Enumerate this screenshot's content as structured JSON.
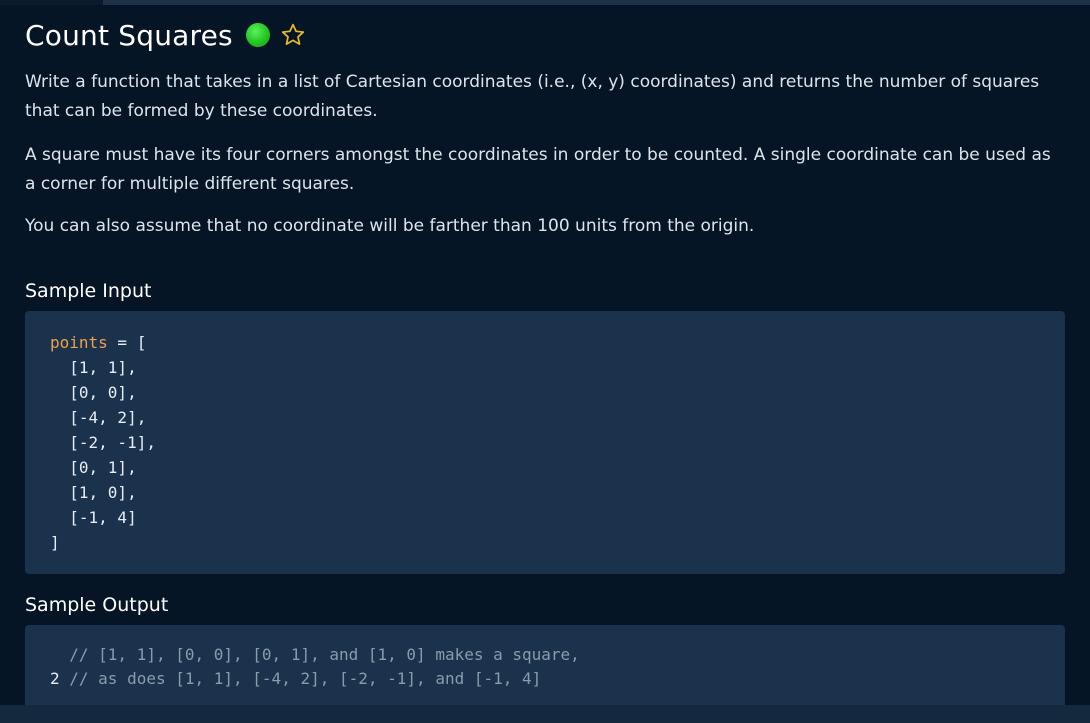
{
  "problem": {
    "title": "Count Squares",
    "status_color": "#21c521",
    "favorite_icon": "star-outline-icon",
    "description": [
      "Write a function that takes in a list of Cartesian coordinates (i.e., (x, y) coordinates) and returns the number of squares that can be formed by these coordinates.",
      "A square must have its four corners amongst the coordinates in order to be counted. A single coordinate can be used as a corner for multiple different squares.",
      "You can also assume that no coordinate will be farther than 100 units from the origin."
    ]
  },
  "sample_input": {
    "heading": "Sample Input",
    "var_name": "points",
    "assign": " = [",
    "lines": [
      "  [1, 1],",
      "  [0, 0],",
      "  [-4, 2],",
      "  [-2, -1],",
      "  [0, 1],",
      "  [1, 0],",
      "  [-1, 4]"
    ],
    "close": "]"
  },
  "sample_output": {
    "heading": "Sample Output",
    "lines": [
      {
        "prefix": "  ",
        "comment": "// [1, 1], [0, 0], [0, 1], and [1, 0] makes a square,"
      },
      {
        "prefix": "2 ",
        "comment": "// as does [1, 1], [-4, 2], [-2, -1], and [-1, 4]"
      }
    ]
  },
  "colors": {
    "background": "#061526",
    "code_background": "#1b324c",
    "keyword": "#f0a04a",
    "comment": "#8a9bab"
  }
}
